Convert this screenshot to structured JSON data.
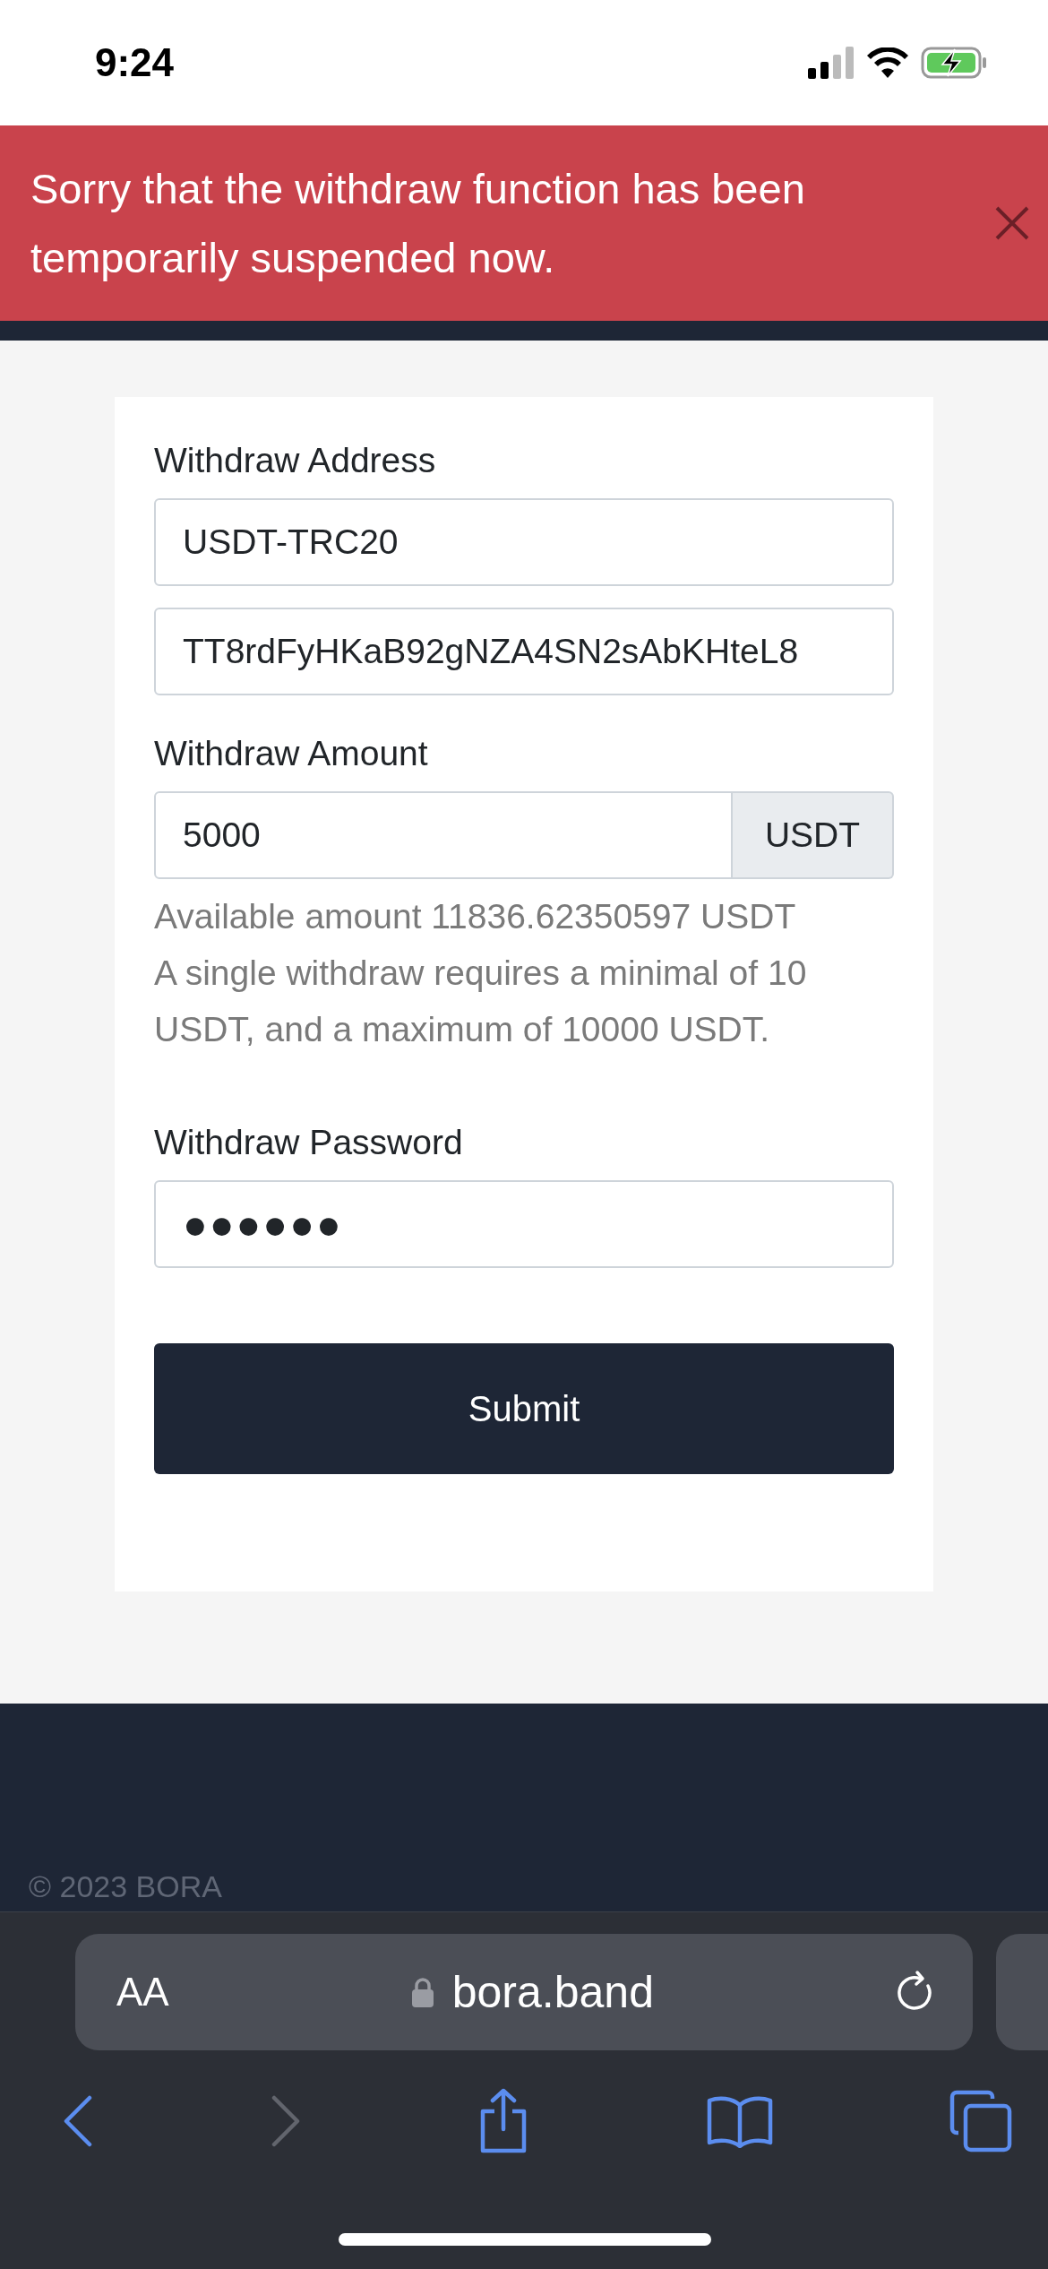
{
  "status_bar": {
    "time": "9:24"
  },
  "alert": {
    "message": "Sorry that the withdraw function has been temporarily suspended now."
  },
  "form": {
    "address": {
      "label": "Withdraw Address",
      "network": "USDT-TRC20",
      "value": "TT8rdFyHKaB92gNZA4SN2sAbKHteL8"
    },
    "amount": {
      "label": "Withdraw Amount",
      "value": "5000",
      "unit": "USDT",
      "notes": [
        "Available amount 11836.62350597 USDT",
        "A single withdraw requires a minimal of 10 USDT, and a maximum of 10000 USDT."
      ]
    },
    "password": {
      "label": "Withdraw Password",
      "masked": "●●●●●●"
    },
    "submit": "Submit"
  },
  "footer": {
    "copyright": "© 2023 BORA"
  },
  "browser": {
    "text_size": "AA",
    "url": "bora.band"
  }
}
